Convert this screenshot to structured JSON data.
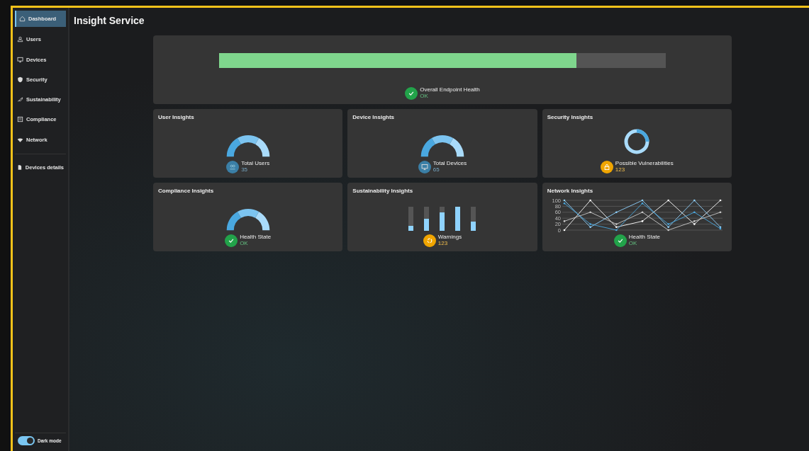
{
  "sidebar": {
    "items": [
      {
        "label": "Dashboard",
        "selected": true
      },
      {
        "label": "Users",
        "selected": false
      },
      {
        "label": "Devices",
        "selected": false
      },
      {
        "label": "Security",
        "selected": false
      },
      {
        "label": "Sustainability",
        "selected": false
      },
      {
        "label": "Compliance",
        "selected": false
      },
      {
        "label": "Network",
        "selected": false
      },
      {
        "label": "Devices details",
        "selected": false,
        "separated": true
      }
    ],
    "dark_mode": {
      "label": "Dark mode",
      "on": true
    }
  },
  "page_title": "Insight Service",
  "health": {
    "level": 0.8,
    "label": "Overall Endpoint Health",
    "value": "OK",
    "color": "#22a34a"
  },
  "cards": [
    {
      "title": "User Insights",
      "kind": "gauge",
      "label": "Total Users",
      "value": "35",
      "color": "#3b7fa6"
    },
    {
      "title": "Device Insights",
      "kind": "gauge",
      "label": "Total Devices",
      "value": "65",
      "color": "#3b7fa6"
    },
    {
      "title": "Security Insights",
      "kind": "donut",
      "label": "Possible Vulnerabilities",
      "value": "123",
      "color": "#f0a500"
    },
    {
      "title": "Compliance Insights",
      "kind": "gauge",
      "label": "Health State",
      "value": "OK",
      "color": "#22a34a"
    },
    {
      "title": "Sustainability Insights",
      "kind": "bars",
      "label": "Warnings",
      "value": "123",
      "color": "#f0a500",
      "bars": [
        {
          "level": 0.2
        },
        {
          "level": 0.5
        },
        {
          "level": 0.75
        },
        {
          "level": 1.0
        },
        {
          "level": 0.38
        }
      ]
    },
    {
      "title": "Network Insights",
      "kind": "lines",
      "label": "Health State",
      "value": "OK",
      "color": "#22a34a",
      "chart_data": {
        "type": "line",
        "grid": true,
        "ylim": [
          0,
          100
        ],
        "yticks": [
          0,
          20,
          40,
          60,
          80,
          100
        ],
        "series": [
          {
            "color": "#ffffff",
            "values": [
              0,
              100,
              10,
              30,
              100,
              20,
              100
            ]
          },
          {
            "color": "#8fd3ff",
            "values": [
              100,
              10,
              60,
              100,
              10,
              100,
              10
            ]
          },
          {
            "color": "#4aa8e0",
            "values": [
              90,
              20,
              0,
              90,
              20,
              60,
              5
            ]
          },
          {
            "color": "#c8c8c8",
            "values": [
              30,
              60,
              20,
              60,
              0,
              30,
              60
            ]
          }
        ]
      }
    }
  ]
}
